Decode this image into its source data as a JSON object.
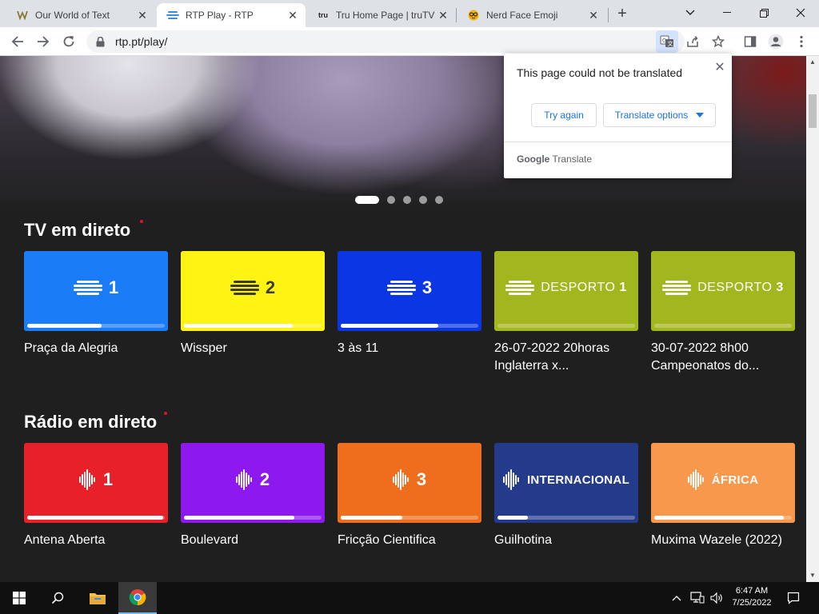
{
  "browser": {
    "tabs": [
      {
        "title": "Our World of Text",
        "favicon": "our-world-of-text-favicon"
      },
      {
        "title": "RTP Play - RTP",
        "favicon": "rtp-favicon"
      },
      {
        "title": "Tru Home Page | truTV",
        "favicon": "trutv-favicon"
      },
      {
        "title": "Nerd Face Emoji",
        "favicon": "nerd-emoji-favicon"
      }
    ],
    "url": "rtp.pt/play/"
  },
  "translate_popup": {
    "message": "This page could not be translated",
    "try_again": "Try again",
    "options": "Translate options",
    "brand_google": "Google",
    "brand_translate": "Translate"
  },
  "tv": {
    "title": "TV em direto",
    "channels": [
      {
        "logo_text": "1",
        "caption_line1": "Praça da Alegria",
        "caption_line2": "",
        "progress": 0.54,
        "color": "#1a7cf7"
      },
      {
        "logo_text": "2",
        "caption_line1": "Wissper",
        "caption_line2": "",
        "progress": 0.79,
        "color": "#fff314"
      },
      {
        "logo_text": "3",
        "caption_line1": "3 às 11",
        "caption_line2": "",
        "progress": 0.71,
        "color": "#0a36e4"
      },
      {
        "logo_prefix": "DESPORTO",
        "logo_text": "1",
        "caption_line1": "26-07-2022 20horas",
        "caption_line2": "Inglaterra x...",
        "progress": 0,
        "color": "#a2b61e"
      },
      {
        "logo_prefix": "DESPORTO",
        "logo_text": "3",
        "caption_line1": "30-07-2022 8h00",
        "caption_line2": "Campeonatos do...",
        "progress": 0,
        "color": "#a2b61e"
      }
    ]
  },
  "radio": {
    "title": "Rádio em direto",
    "stations": [
      {
        "logo_text": "1",
        "caption": "Antena Aberta",
        "progress": 0.99,
        "color": "#e8202a"
      },
      {
        "logo_text": "2",
        "caption": "Boulevard",
        "progress": 0.8,
        "color": "#8e19ef"
      },
      {
        "logo_text": "3",
        "caption": "Fricção Cientifica",
        "progress": 0.45,
        "color": "#ee6e1e"
      },
      {
        "logo_text": "INTERNACIONAL",
        "caption": "Guilhotina",
        "progress": 0.22,
        "color": "#243b8c"
      },
      {
        "logo_text": "ÁFRICA",
        "caption": "Muxima Wazele (2022)",
        "progress": 0.94,
        "color": "#f7984c"
      }
    ]
  },
  "taskbar": {
    "time": "6:47 AM",
    "date": "7/25/2022"
  }
}
